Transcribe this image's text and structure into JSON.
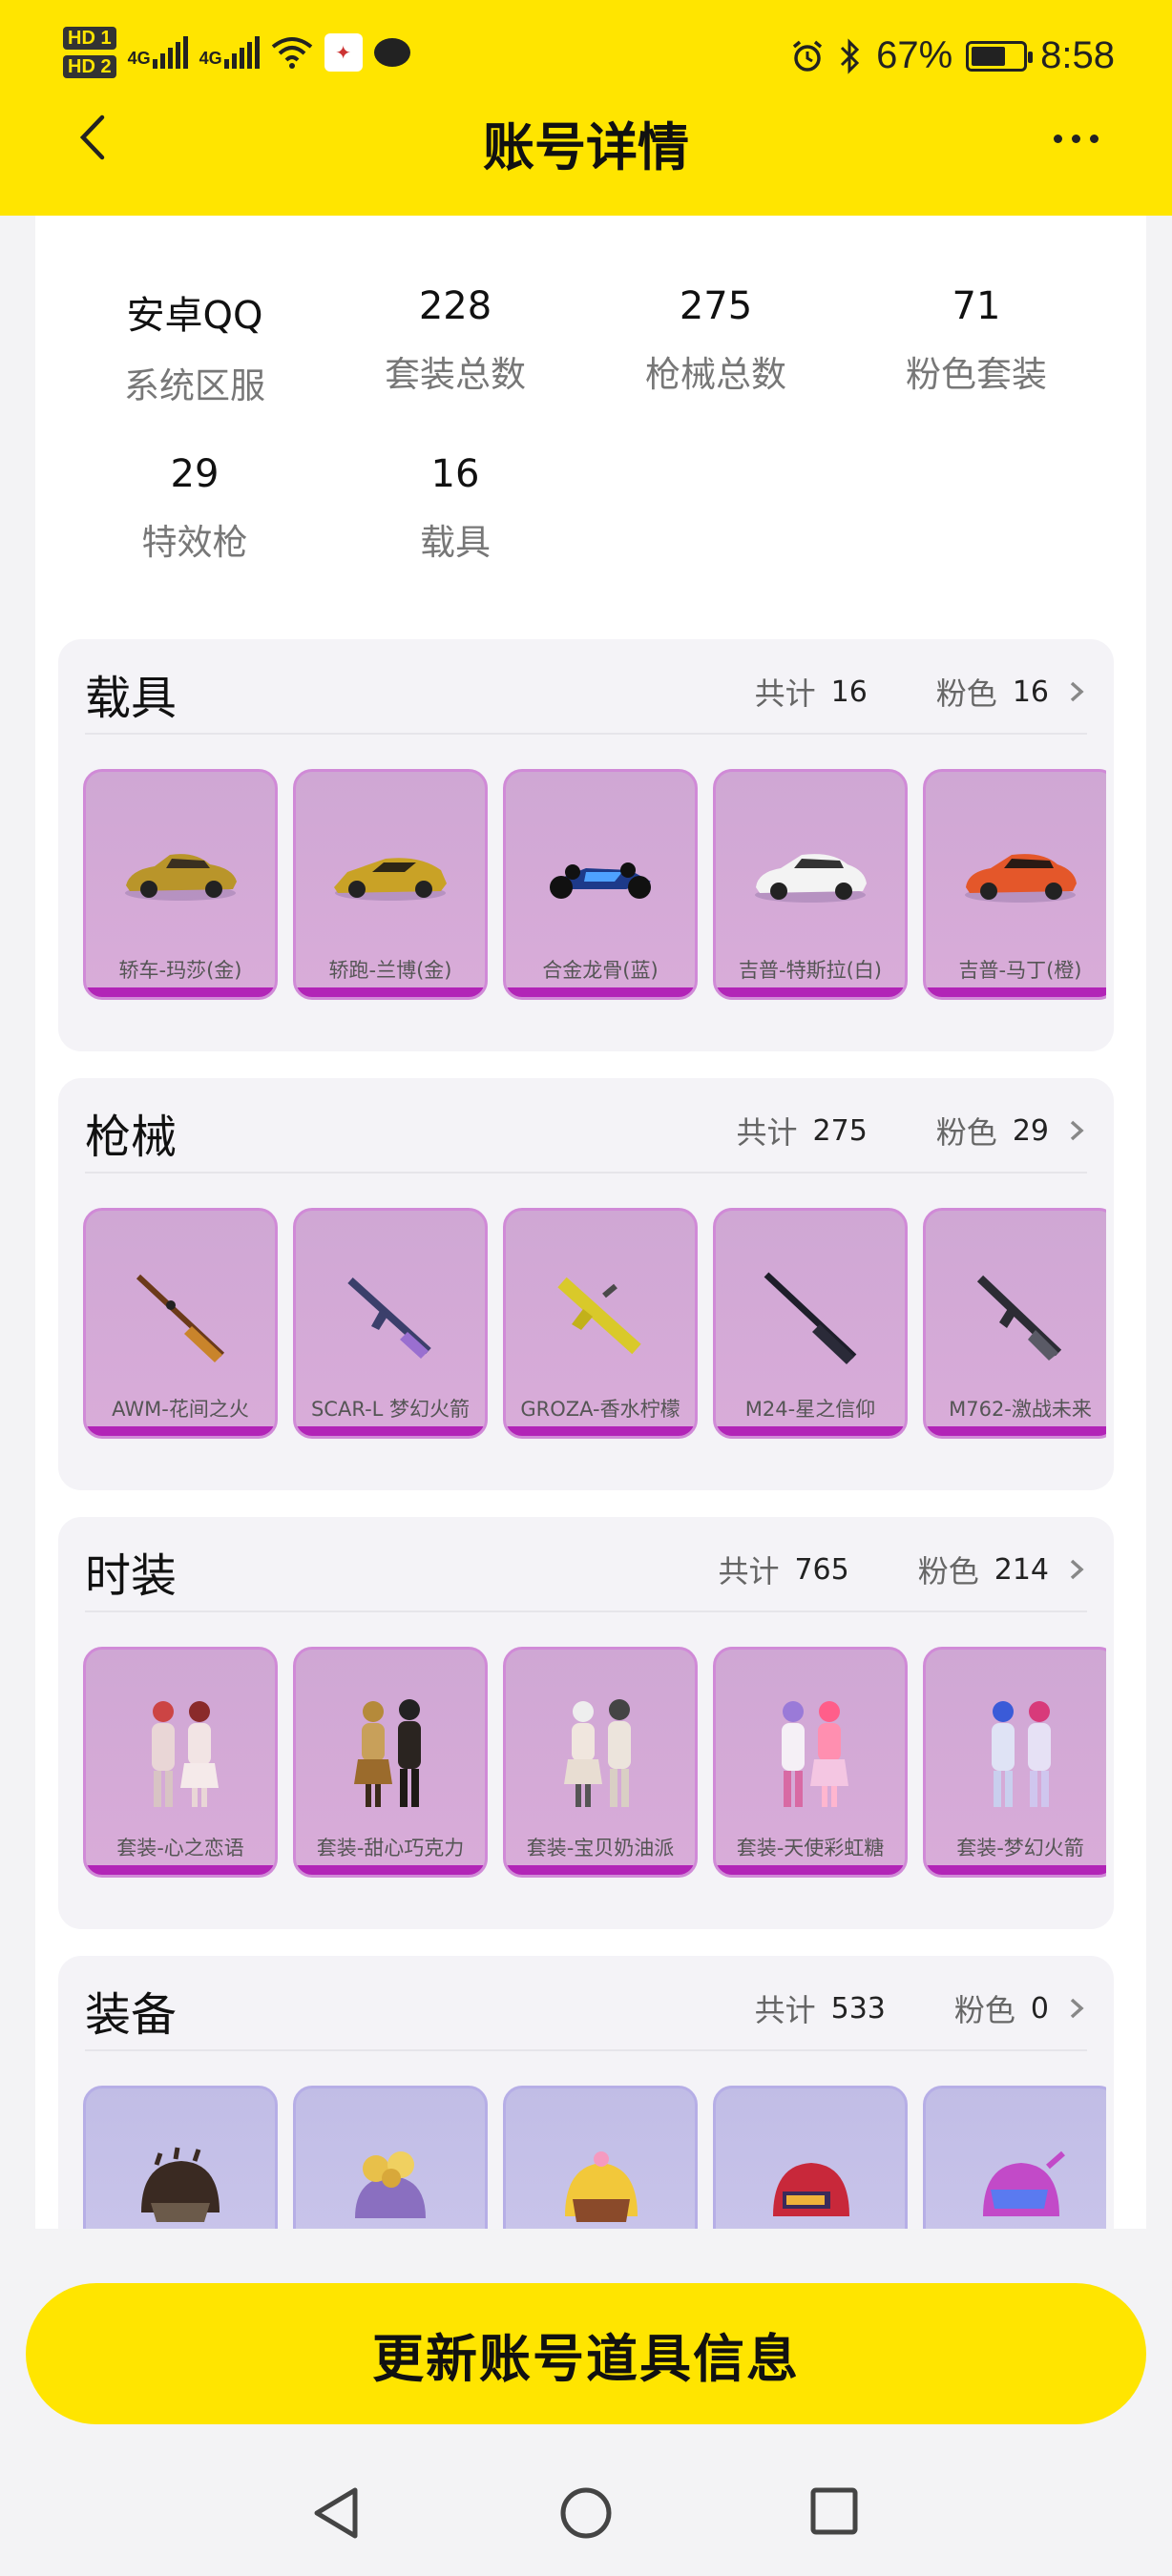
{
  "status_bar": {
    "hd1": "HD 1",
    "hd2": "HD 2",
    "net1": "4G",
    "net2": "4G",
    "battery_percent": "67%",
    "battery_level": 0.67,
    "time": "8:58",
    "icons": [
      "hd-icon",
      "signal-icon",
      "wifi-icon",
      "app-notification-icon",
      "message-icon",
      "alarm-icon",
      "bluetooth-icon",
      "battery-icon"
    ]
  },
  "header": {
    "title": "账号详情",
    "background": "#ffe500"
  },
  "stats": [
    {
      "value": "安卓QQ",
      "label": "系统区服"
    },
    {
      "value": "228",
      "label": "套装总数"
    },
    {
      "value": "275",
      "label": "枪械总数"
    },
    {
      "value": "71",
      "label": "粉色套装"
    },
    {
      "value": "29",
      "label": "特效枪"
    },
    {
      "value": "16",
      "label": "载具"
    }
  ],
  "sections": [
    {
      "title": "载具",
      "total_label": "共计",
      "total": "16",
      "pink_label": "粉色",
      "pink": "16",
      "items": [
        "轿车-玛莎(金)",
        "轿跑-兰博(金)",
        "合金龙骨(蓝)",
        "吉普-特斯拉(白)",
        "吉普-马丁(橙)"
      ]
    },
    {
      "title": "枪械",
      "total_label": "共计",
      "total": "275",
      "pink_label": "粉色",
      "pink": "29",
      "items": [
        "AWM-花间之火",
        "SCAR-L 梦幻火箭",
        "GROZA-香水柠檬",
        "M24-星之信仰",
        "M762-激战未来"
      ]
    },
    {
      "title": "时装",
      "total_label": "共计",
      "total": "765",
      "pink_label": "粉色",
      "pink": "214",
      "items": [
        "套装-心之恋语",
        "套装-甜心巧克力",
        "套装-宝贝奶油派",
        "套装-天使彩虹糖",
        "套装-梦幻火箭"
      ]
    },
    {
      "title": "装备",
      "total_label": "共计",
      "total": "533",
      "pink_label": "粉色",
      "pink": "0",
      "items": [
        "",
        "",
        "",
        "",
        ""
      ]
    }
  ],
  "cta": {
    "label": "更新账号道具信息"
  },
  "colors": {
    "accent": "#ffe500",
    "pink_card": "#d9acd9",
    "pink_bar": "#b224b7",
    "blue_card": "#cfcaee"
  }
}
